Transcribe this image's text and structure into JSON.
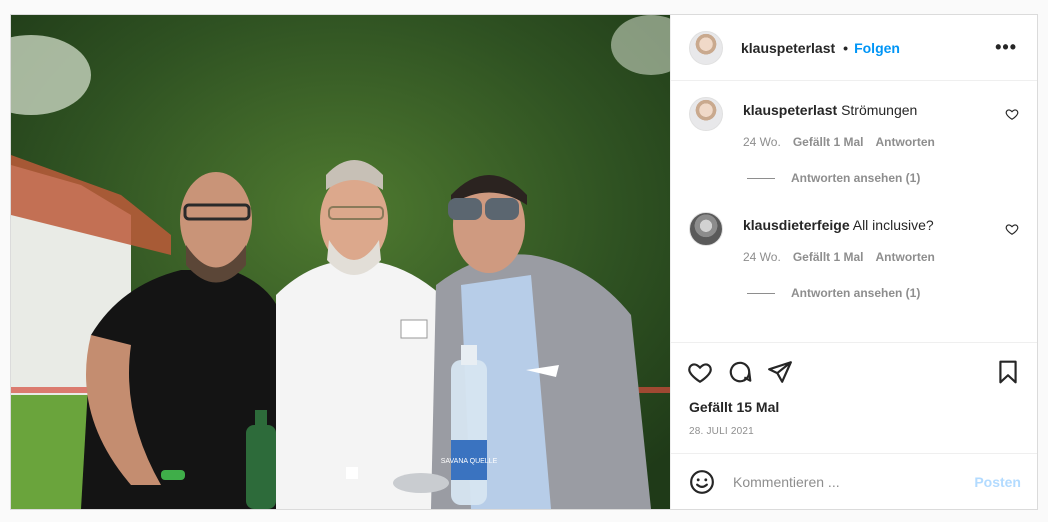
{
  "post": {
    "author": "klauspeterlast",
    "follow_label": "Folgen",
    "separator": "•",
    "more_label": "•••"
  },
  "photo": {
    "description_icon": "photo-of-three-men",
    "bottle_label_left": "",
    "bottle_label_right": "SAVANA QUELLE"
  },
  "comments": [
    {
      "user": "klauspeterlast",
      "text": "Strömungen",
      "age": "24 Wo.",
      "likes": "Gefällt 1 Mal",
      "reply_label": "Antworten",
      "view_replies": "Antworten ansehen (1)"
    },
    {
      "user": "klausdieterfeige",
      "text": "All inclusive?",
      "age": "24 Wo.",
      "likes": "Gefällt 1 Mal",
      "reply_label": "Antworten",
      "view_replies": "Antworten ansehen (1)"
    }
  ],
  "actions": {
    "icons": [
      "heart-icon",
      "comment-icon",
      "share-icon",
      "bookmark-icon"
    ]
  },
  "likes_text": "Gefällt 15 Mal",
  "date_text": "28. Juli 2021",
  "add_comment": {
    "placeholder": "Kommentieren ...",
    "post_label": "Posten"
  },
  "colors": {
    "accent": "#0095f6",
    "post_disabled": "#b3dbff",
    "muted": "#8e8e8e",
    "border": "#dbdbdb"
  }
}
